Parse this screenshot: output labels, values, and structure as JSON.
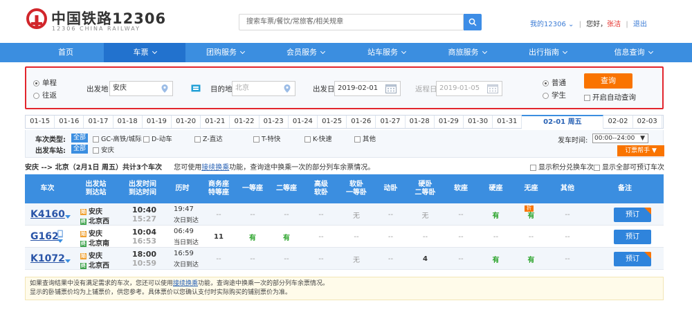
{
  "header": {
    "logo_title": "中国铁路12306",
    "logo_subtitle": "12306 CHINA RAILWAY",
    "search_placeholder": "搜索车票/餐饮/常旅客/相关规章",
    "my_account": "我的12306",
    "greeting": "您好，",
    "user_name": "张洁",
    "logout": "退出"
  },
  "nav": {
    "items": [
      {
        "label": "首页",
        "active": false,
        "caret": false
      },
      {
        "label": "车票",
        "active": true,
        "caret": true
      },
      {
        "label": "团购服务",
        "active": false,
        "caret": true
      },
      {
        "label": "会员服务",
        "active": false,
        "caret": true
      },
      {
        "label": "站车服务",
        "active": false,
        "caret": true
      },
      {
        "label": "商旅服务",
        "active": false,
        "caret": true
      },
      {
        "label": "出行指南",
        "active": false,
        "caret": true
      },
      {
        "label": "信息查询",
        "active": false,
        "caret": true
      }
    ]
  },
  "query": {
    "trip_oneway": "单程",
    "trip_round": "往返",
    "from_label": "出发地",
    "from_value": "安庆",
    "to_label": "目的地",
    "to_value": "北京",
    "depart_label": "出发日",
    "depart_value": "2019-02-01",
    "return_label": "返程日",
    "return_value": "2019-01-05",
    "type_normal": "普通",
    "type_student": "学生",
    "query_button": "查询",
    "auto_query": "开启自动查询"
  },
  "dates": [
    "01-15",
    "01-16",
    "01-17",
    "01-18",
    "01-19",
    "01-20",
    "01-21",
    "01-22",
    "01-23",
    "01-24",
    "01-25",
    "01-26",
    "01-27",
    "01-28",
    "01-29",
    "01-30",
    "01-31",
    "02-01 周五",
    "02-02",
    "02-03"
  ],
  "selected_date_index": 17,
  "filters": {
    "type_label": "车次类型:",
    "station_label": "出发车站:",
    "all_tag": "全部",
    "types": [
      "GC-高铁/城际",
      "D-动车",
      "Z-直达",
      "T-特快",
      "K-快速",
      "其他"
    ],
    "station_option": "安庆",
    "time_label": "发车时间:",
    "time_value": "00:00--24:00",
    "book_helper": "订票帮手"
  },
  "summary": {
    "route": "安庆 --> 北京（2月1日 周五）共计",
    "count": "3",
    "count_suffix": "个车次",
    "tip_prefix": "您可使用",
    "tip_link": "接续换乘",
    "tip_suffix": "功能，查询途中换乘一次的部分列车余票情况。",
    "option_partial": "显示积分兑换车次",
    "option_all": "显示全部可预订车次"
  },
  "table": {
    "headers": [
      "车次",
      "出发站\n到达站",
      "出发时间\n到达时间",
      "历时",
      "商务座\n特等座",
      "一等座",
      "二等座",
      "高级\n软卧",
      "软卧\n一等卧",
      "动卧",
      "硬卧\n二等卧",
      "软座",
      "硬座",
      "无座",
      "其他",
      "备注"
    ],
    "book_label": "预订",
    "discount_tag": "折",
    "rows": [
      {
        "train": "K4160",
        "from": "安庆",
        "to": "北京西",
        "dep": "10:40",
        "arr": "15:27",
        "dur": "19:47",
        "day": "次日到达",
        "seats": [
          "--",
          "--",
          "--",
          "--",
          "无",
          "--",
          "无",
          "--",
          "有",
          "有",
          "--"
        ],
        "discount": true,
        "corner": true,
        "phone": false
      },
      {
        "train": "G162",
        "from": "安庆",
        "to": "北京南",
        "dep": "10:04",
        "arr": "16:53",
        "dur": "06:49",
        "day": "当日到达",
        "seats": [
          "11",
          "有",
          "有",
          "--",
          "--",
          "--",
          "--",
          "--",
          "--",
          "--",
          "--"
        ],
        "discount": false,
        "corner": false,
        "phone": true
      },
      {
        "train": "K1072",
        "from": "安庆",
        "to": "北京西",
        "dep": "18:00",
        "arr": "10:59",
        "dur": "16:59",
        "day": "次日到达",
        "seats": [
          "--",
          "--",
          "--",
          "--",
          "无",
          "--",
          "4",
          "--",
          "有",
          "有",
          "--"
        ],
        "discount": false,
        "corner": true,
        "phone": false
      }
    ]
  },
  "footnote": {
    "line1_prefix": "如果查询结果中没有满足需求的车次，您还可以使用",
    "line1_link": "接续换乘",
    "line1_suffix": "功能，查询途中换乘一次的部分列车余票情况。",
    "line2": "显示的卧铺票价均为上铺票价，供您参考。具体票价以您确认支付时实际购买的铺别票价为准。"
  },
  "colors": {
    "accent": "#3b8ee0",
    "highlight": "#e2252d",
    "orange": "#f97400",
    "available": "#2ea52e"
  }
}
